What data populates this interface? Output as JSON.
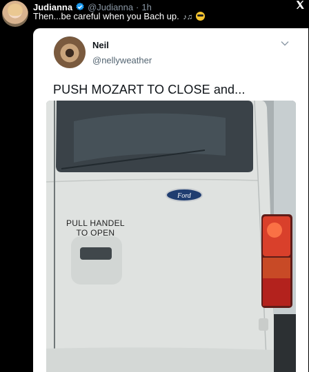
{
  "tweet": {
    "display_name": "Judianna",
    "handle": "@Judianna",
    "separator": "·",
    "time": "1h",
    "text": "Then...be careful when you Bach up.",
    "emoji_notes": "♪♫"
  },
  "quoted_tweet": {
    "display_name": "Neil",
    "handle": "@nellyweather",
    "text": "PUSH MOZART TO CLOSE and..."
  },
  "photo": {
    "sticker_line1": "PULL HANDEL",
    "sticker_line2": "TO OPEN",
    "badge_text": "Ford"
  },
  "colors": {
    "background": "#000000",
    "verified": "#1d9bf0",
    "handle_gray": "#8b98a5",
    "van_white": "#dfe2e0"
  },
  "icons": [
    "verified-badge-icon",
    "x-logo-icon",
    "chevron-down-icon"
  ]
}
